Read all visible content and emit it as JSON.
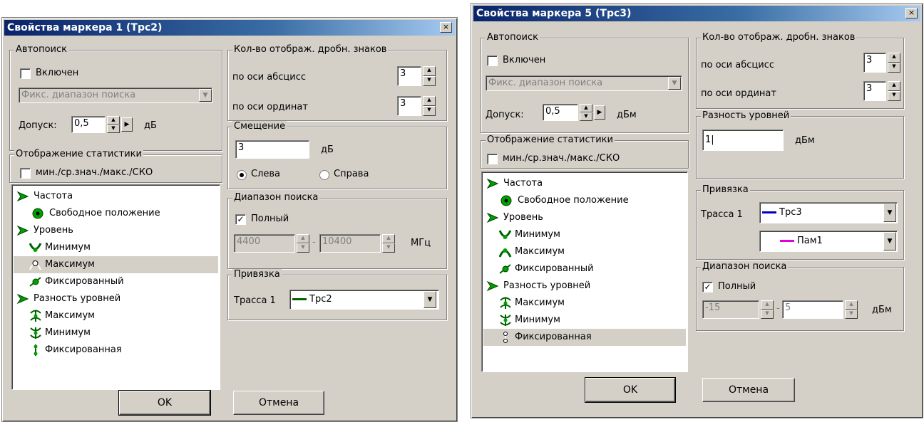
{
  "left": {
    "title": "Свойства маркера 1 (Трс2)",
    "autosearch": {
      "legend": "Автопоиск",
      "enabled_label": "Включен",
      "mode": "Фикс. диапазон поиска",
      "tol_label": "Допуск:",
      "tol_value": "0,5",
      "tol_unit": "дБ"
    },
    "stats": {
      "legend": "Отображение статистики",
      "label": "мин./ср.знач./макс./СКО"
    },
    "list": [
      {
        "label": "Частота"
      },
      {
        "label": "Свободное положение"
      },
      {
        "label": "Уровень"
      },
      {
        "label": "Минимум"
      },
      {
        "label": "Максимум"
      },
      {
        "label": "Фиксированный"
      },
      {
        "label": "Разность уровней"
      },
      {
        "label": "Максимум"
      },
      {
        "label": "Минимум"
      },
      {
        "label": "Фиксированная"
      }
    ],
    "decimals": {
      "legend": "Кол-во отображ. дробн. знаков",
      "x_label": "по оси абсцисс",
      "x_value": "3",
      "y_label": "по оси ординат",
      "y_value": "3"
    },
    "offset": {
      "legend": "Смещение",
      "value": "3",
      "unit": "дБ",
      "left": "Слева",
      "right": "Справа"
    },
    "range": {
      "legend": "Диапазон поиска",
      "full_label": "Полный",
      "from": "4400",
      "to": "10400",
      "unit": "МГц"
    },
    "bind": {
      "legend": "Привязка",
      "trace_label": "Трасса 1",
      "trace_value": "Трс2",
      "trace_color": "#006400"
    },
    "ok": "OK",
    "cancel": "Отмена"
  },
  "right": {
    "title": "Свойства маркера 5 (Трс3)",
    "autosearch": {
      "legend": "Автопоиск",
      "enabled_label": "Включен",
      "mode": "Фикс. диапазон поиска",
      "tol_label": "Допуск:",
      "tol_value": "0,5",
      "tol_unit": "дБм"
    },
    "stats": {
      "legend": "Отображение статистики",
      "label": "мин./ср.знач./макс./СКО"
    },
    "list": [
      {
        "label": "Частота"
      },
      {
        "label": "Свободное положение"
      },
      {
        "label": "Уровень"
      },
      {
        "label": "Минимум"
      },
      {
        "label": "Максимум"
      },
      {
        "label": "Фиксированный"
      },
      {
        "label": "Разность уровней"
      },
      {
        "label": "Максимум"
      },
      {
        "label": "Минимум"
      },
      {
        "label": "Фиксированная"
      }
    ],
    "decimals": {
      "legend": "Кол-во отображ. дробн. знаков",
      "x_label": "по оси абсцисс",
      "x_value": "3",
      "y_label": "по оси ординат",
      "y_value": "3"
    },
    "diff": {
      "legend": "Разность уровней",
      "value": "1",
      "unit": "дБм"
    },
    "bind": {
      "legend": "Привязка",
      "trace_label": "Трасса 1",
      "trace_value": "Трс3",
      "trace_color": "#0000c0",
      "trace2_value": "Пам1",
      "trace2_color": "#e000e0"
    },
    "range": {
      "legend": "Диапазон поиска",
      "full_label": "Полный",
      "from": "-15",
      "to": "5",
      "unit": "дБм"
    },
    "ok": "OK",
    "cancel": "Отмена"
  }
}
